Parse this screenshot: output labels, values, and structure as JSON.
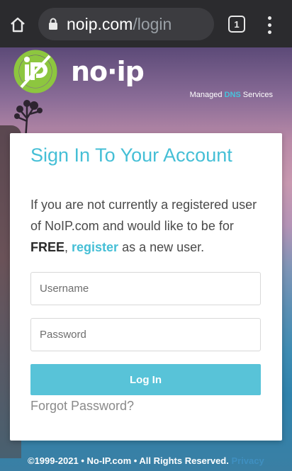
{
  "browser": {
    "url_host": "noip.com",
    "url_path": "/login",
    "tab_count": "1"
  },
  "brand": {
    "logo_word": "no·ip",
    "tagline_pre": "Managed ",
    "tagline_dns": "DNS",
    "tagline_post": " Services"
  },
  "login": {
    "title": "Sign In To Your Account",
    "intro": "If you are not currently a registered user of NoIP.com and would like to be for ",
    "free": "FREE",
    "comma": ", ",
    "register_link": "register",
    "intro_end": " as a new user.",
    "username_placeholder": "Username",
    "password_placeholder": "Password",
    "login_button": "Log In",
    "forgot_link": "Forgot Password?"
  },
  "footer": {
    "copyright": "©1999-2021 • No-IP.com • All Rights Reserved. ",
    "privacy": "Privacy"
  },
  "colors": {
    "accent": "#45bfd6",
    "button": "#58c3d8",
    "logo_green": "#8dc63f"
  }
}
